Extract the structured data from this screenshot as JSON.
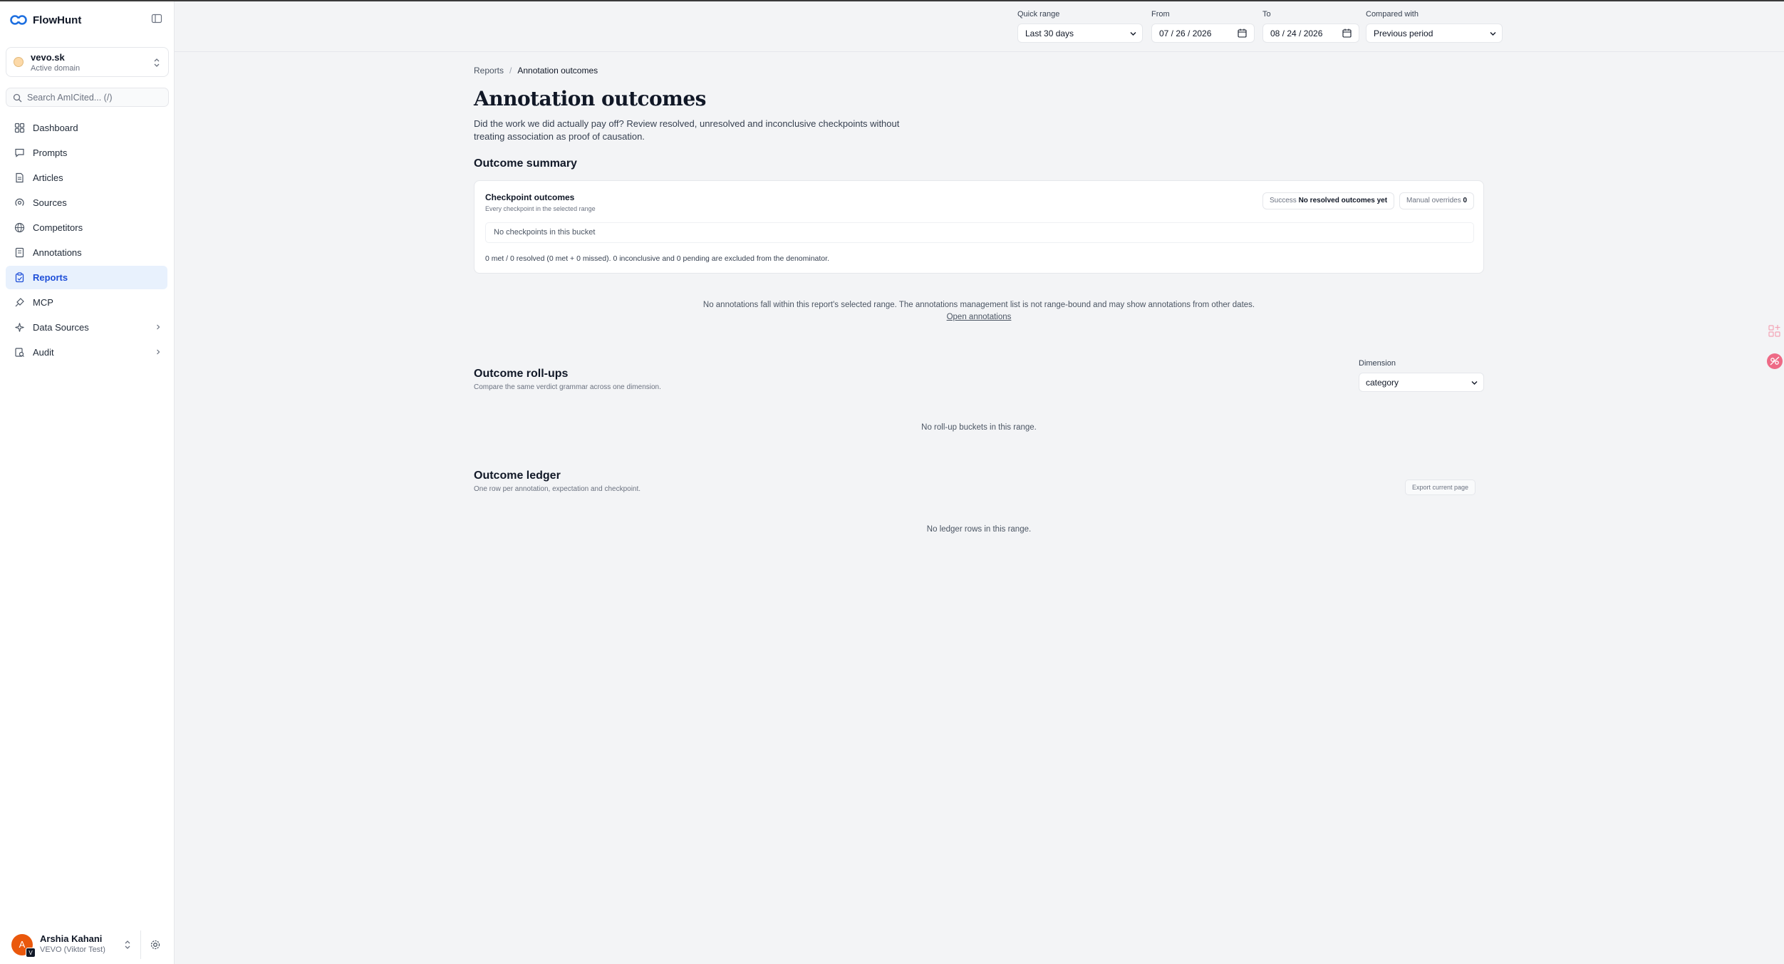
{
  "app": {
    "name": "FlowHunt"
  },
  "domain": {
    "name": "vevo.sk",
    "subtitle": "Active domain"
  },
  "search": {
    "placeholder": "Search AmICited... (/)"
  },
  "nav": [
    {
      "label": "Dashboard",
      "icon": "grid-icon"
    },
    {
      "label": "Prompts",
      "icon": "chat-icon"
    },
    {
      "label": "Articles",
      "icon": "document-icon"
    },
    {
      "label": "Sources",
      "icon": "radar-icon"
    },
    {
      "label": "Competitors",
      "icon": "globe-icon"
    },
    {
      "label": "Annotations",
      "icon": "notes-icon"
    },
    {
      "label": "Reports",
      "icon": "clipboard-icon",
      "active": true
    },
    {
      "label": "MCP",
      "icon": "plug-icon"
    },
    {
      "label": "Data Sources",
      "icon": "sparkle-icon",
      "expandable": true
    },
    {
      "label": "Audit",
      "icon": "audit-icon",
      "expandable": true
    }
  ],
  "user": {
    "name": "Arshia Kahani",
    "org": "VEVO (Viktor Test)",
    "initial": "A",
    "badge": "V"
  },
  "filters": {
    "quick_range_label": "Quick range",
    "quick_range_value": "Last 30 days",
    "from_label": "From",
    "from_value": "07 / 26 / 2026",
    "to_label": "To",
    "to_value": "08 / 24 / 2026",
    "compared_label": "Compared with",
    "compared_value": "Previous period"
  },
  "breadcrumb": {
    "parent": "Reports",
    "separator": "/",
    "current": "Annotation outcomes"
  },
  "page": {
    "title": "Annotation outcomes",
    "description": "Did the work we did actually pay off? Review resolved, unresolved and inconclusive checkpoints without treating association as proof of causation."
  },
  "summary": {
    "section_title": "Outcome summary",
    "card_title": "Checkpoint outcomes",
    "card_subtitle": "Every checkpoint in the selected range",
    "success_label": "Success",
    "success_value": "No resolved outcomes yet",
    "overrides_label": "Manual overrides",
    "overrides_value": "0",
    "bucket_empty": "No checkpoints in this bucket",
    "math_note": "0 met / 0 resolved (0 met + 0 missed). 0 inconclusive and 0 pending are excluded from the denominator."
  },
  "range_note": "No annotations fall within this report's selected range. The annotations management list is not range-bound and may show annotations from other dates.",
  "open_annotations_link": "Open annotations",
  "rollups": {
    "title": "Outcome roll-ups",
    "subtitle": "Compare the same verdict grammar across one dimension.",
    "dimension_label": "Dimension",
    "dimension_value": "category",
    "empty": "No roll-up buckets in this range."
  },
  "ledger": {
    "title": "Outcome ledger",
    "subtitle": "One row per annotation, expectation and checkpoint.",
    "export_label": "Export current page",
    "empty": "No ledger rows in this range."
  },
  "colors": {
    "accent": "#1d4ed8",
    "active_bg": "#e8f1fd",
    "avatar": "#ea580c"
  }
}
